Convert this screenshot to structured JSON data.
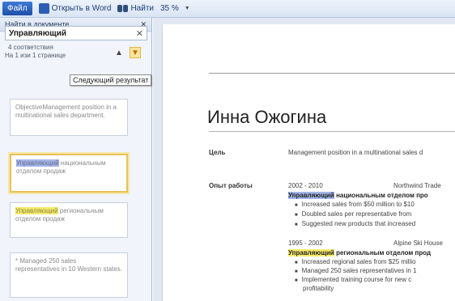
{
  "toolbar": {
    "file_label": "Файл",
    "open_in_word": "Открыть в Word",
    "find": "Найти",
    "zoom": "35 %"
  },
  "nav_pane": {
    "title": "Найти в документе",
    "search_value": "Управляющий",
    "match_count": "4 соответствия",
    "page_info": "На 1 изи 1 странице",
    "tooltip": "Следующий результат",
    "results": [
      {
        "pre": "ObjectiveManagement",
        "rest": "position in a multinational sales department."
      },
      {
        "pre": "Управляющий",
        "rest": "национальным отделом продаж"
      },
      {
        "pre": "Управляющий",
        "rest": "региональным отделом продаж"
      },
      {
        "pre": "* Managed",
        "rest": "250 sales representatives in 10 Western states."
      }
    ]
  },
  "document": {
    "name": "Инна Ожогина",
    "objective_label": "Цель",
    "objective_text": "Management position in a multinational sales d",
    "experience_label": "Опыт работы",
    "job1_years": "2002 - 2010",
    "job1_company": "Northwind Trade",
    "job1_title_hl": "Управляющий",
    "job1_title_rest": "национальным отделом про",
    "job1_bullets": [
      "Increased sales from $50 million to $10",
      "Doubled sales per representative from",
      "Suggested new products that increased"
    ],
    "job2_years": "1995 - 2002",
    "job2_company": "Alpine Ski House",
    "job2_title_hl": "Управляющий",
    "job2_title_rest": "региональным отделом прод",
    "job2_bullets": [
      "Increased regional sales from $25 millio",
      "Managed 250 sales representatives in 1",
      "Implemented training course for new c",
      "profitability"
    ]
  }
}
